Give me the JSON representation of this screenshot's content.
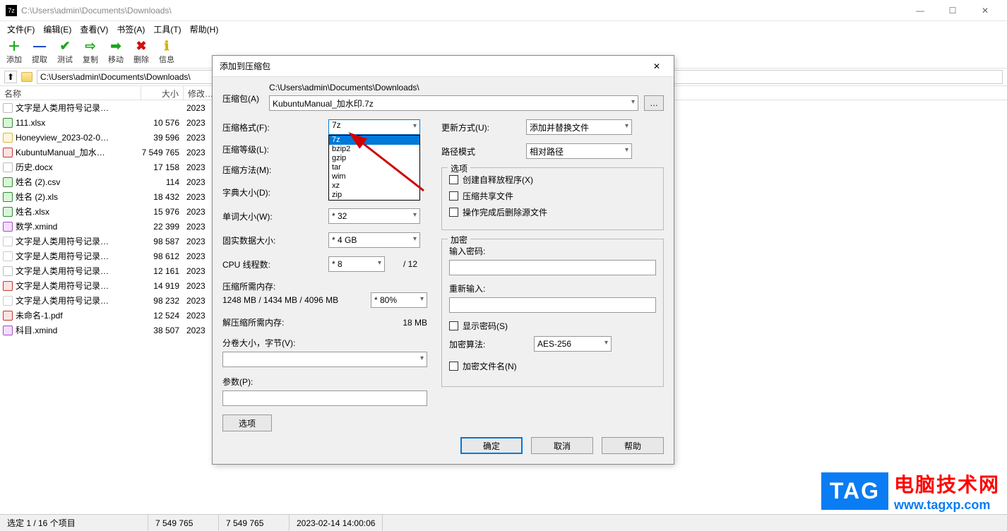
{
  "window": {
    "title": "C:\\Users\\admin\\Documents\\Downloads\\",
    "app_icon_text": "7z"
  },
  "menubar": [
    "文件(F)",
    "编辑(E)",
    "查看(V)",
    "书签(A)",
    "工具(T)",
    "帮助(H)"
  ],
  "toolbar": [
    {
      "icon": "＋",
      "lbl": "添加",
      "color": "#17a817"
    },
    {
      "icon": "—",
      "lbl": "提取",
      "color": "#1040c0"
    },
    {
      "icon": "✔",
      "lbl": "测试",
      "color": "#17a817"
    },
    {
      "icon": "⇨",
      "lbl": "复制",
      "color": "#17a817"
    },
    {
      "icon": "➡",
      "lbl": "移动",
      "color": "#17a817"
    },
    {
      "icon": "✖",
      "lbl": "删除",
      "color": "#d01010"
    },
    {
      "icon": "ℹ",
      "lbl": "信息",
      "color": "#d8b000"
    }
  ],
  "addressbar": {
    "path": "C:\\Users\\admin\\Documents\\Downloads\\"
  },
  "columns": {
    "name": "名称",
    "size": "大小",
    "modified": "修改…"
  },
  "files": [
    {
      "cls": "f-doc",
      "name": "文字是人类用符号记录…",
      "size": "",
      "mod": "2023"
    },
    {
      "cls": "f-xlsx",
      "name": "111.xlsx",
      "size": "10 576",
      "mod": "2023"
    },
    {
      "cls": "f-zip",
      "name": "Honeyview_2023-02-0…",
      "size": "39 596",
      "mod": "2023"
    },
    {
      "cls": "f-pdf",
      "name": "KubuntuManual_加水…",
      "size": "7 549 765",
      "mod": "2023"
    },
    {
      "cls": "f-doc",
      "name": "历史.docx",
      "size": "17 158",
      "mod": "2023"
    },
    {
      "cls": "f-xlsx",
      "name": "姓名 (2).csv",
      "size": "114",
      "mod": "2023"
    },
    {
      "cls": "f-xlsx",
      "name": "姓名 (2).xls",
      "size": "18 432",
      "mod": "2023"
    },
    {
      "cls": "f-xlsx",
      "name": "姓名.xlsx",
      "size": "15 976",
      "mod": "2023"
    },
    {
      "cls": "f-xmind",
      "name": "数学.xmind",
      "size": "22 399",
      "mod": "2023"
    },
    {
      "cls": "f-txt",
      "name": "文字是人类用符号记录…",
      "size": "98 587",
      "mod": "2023"
    },
    {
      "cls": "f-txt",
      "name": "文字是人类用符号记录…",
      "size": "98 612",
      "mod": "2023"
    },
    {
      "cls": "f-doc",
      "name": "文字是人类用符号记录…",
      "size": "12 161",
      "mod": "2023"
    },
    {
      "cls": "f-pdf",
      "name": "文字是人类用符号记录…",
      "size": "14 919",
      "mod": "2023"
    },
    {
      "cls": "f-txt",
      "name": "文字是人类用符号记录…",
      "size": "98 232",
      "mod": "2023"
    },
    {
      "cls": "f-pdf",
      "name": "未命名-1.pdf",
      "size": "12 524",
      "mod": "2023"
    },
    {
      "cls": "f-xmind",
      "name": "科目.xmind",
      "size": "38 507",
      "mod": "2023"
    }
  ],
  "statusbar": {
    "sel": "选定 1 / 16 个项目",
    "s1": "7 549 765",
    "s2": "7 549 765",
    "date": "2023-02-14 14:00:06"
  },
  "dialog": {
    "title": "添加到压缩包",
    "archive_label": "压缩包(A)",
    "archive_path": "C:\\Users\\admin\\Documents\\Downloads\\",
    "archive_name": "KubuntuManual_加水印.7z",
    "format_label": "压缩格式(F):",
    "format_value": "7z",
    "format_options": [
      "7z",
      "bzip2",
      "gzip",
      "tar",
      "wim",
      "xz",
      "zip"
    ],
    "level_label": "压缩等级(L):",
    "method_label": "压缩方法(M):",
    "dict_label": "字典大小(D):",
    "dict_value": "",
    "word_label": "单词大小(W):",
    "word_value": "* 32",
    "solid_label": "固实数据大小:",
    "solid_value": "* 4 GB",
    "cpu_label": "CPU 线程数:",
    "cpu_value": "* 8",
    "cpu_total": "/ 12",
    "mem_comp_label": "压缩所需内存:",
    "mem_comp_value": "1248 MB / 1434 MB / 4096 MB",
    "mem_comp_pct": "* 80%",
    "mem_decomp_label": "解压缩所需内存:",
    "mem_decomp_value": "18 MB",
    "split_label": "分卷大小，字节(V):",
    "params_label": "参数(P):",
    "options_button": "选项",
    "update_label": "更新方式(U):",
    "update_value": "添加并替换文件",
    "path_label": "路径模式",
    "path_value": "相对路径",
    "options_legend": "选项",
    "opt_sfx": "创建自释放程序(X)",
    "opt_share": "压缩共享文件",
    "opt_delete": "操作完成后删除源文件",
    "enc_legend": "加密",
    "enc_pw": "输入密码:",
    "enc_pw2": "重新输入:",
    "enc_show": "显示密码(S)",
    "enc_algo_label": "加密算法:",
    "enc_algo_value": "AES-256",
    "enc_names": "加密文件名(N)",
    "btn_ok": "确定",
    "btn_cancel": "取消",
    "btn_help": "帮助"
  },
  "watermark": {
    "tag": "TAG",
    "cn": "电脑技术网",
    "url": "www.tagxp.com"
  }
}
